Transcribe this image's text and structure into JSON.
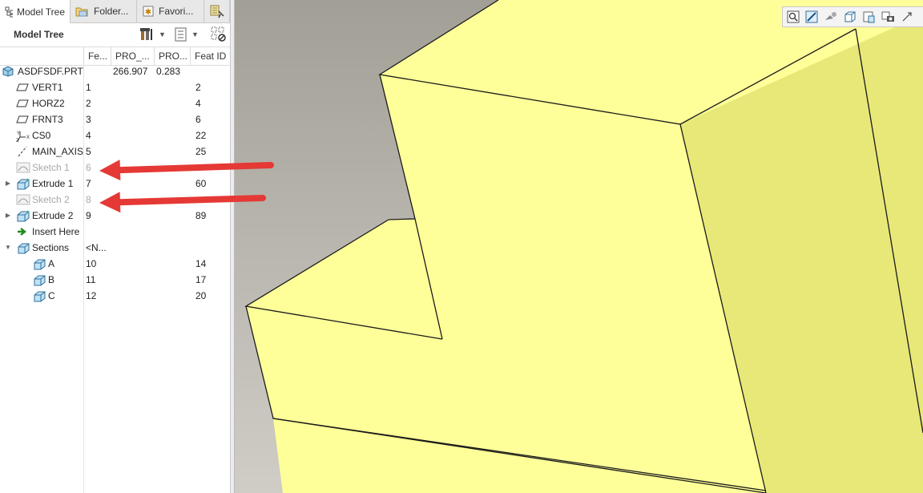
{
  "tabs": [
    {
      "label": "Model Tree",
      "icon": "model-tree-icon"
    },
    {
      "label": "Folder...",
      "icon": "folder-browser-icon"
    },
    {
      "label": "Favori...",
      "icon": "favorites-icon"
    },
    {
      "label": "",
      "icon": "layers-icon"
    }
  ],
  "panel": {
    "title": "Model Tree",
    "tools": [
      "settings-icon",
      "show-list-icon",
      "filter-icon"
    ]
  },
  "columns": [
    "",
    "Fe...",
    "PRO_...",
    "PRO...",
    "Feat ID"
  ],
  "tree": [
    {
      "name": "ASDFSDF.PRT",
      "c1": "",
      "c2": "266.907",
      "c3": "0.283",
      "c4": "",
      "indent": 0,
      "icon": "part-icon",
      "expand": "",
      "suppressed": false
    },
    {
      "name": "VERT1",
      "c1": "1",
      "c2": "",
      "c3": "",
      "c4": "2",
      "indent": 1,
      "icon": "datum-plane-icon",
      "expand": "",
      "suppressed": false
    },
    {
      "name": "HORZ2",
      "c1": "2",
      "c2": "",
      "c3": "",
      "c4": "4",
      "indent": 1,
      "icon": "datum-plane-icon",
      "expand": "",
      "suppressed": false
    },
    {
      "name": "FRNT3",
      "c1": "3",
      "c2": "",
      "c3": "",
      "c4": "6",
      "indent": 1,
      "icon": "datum-plane-icon",
      "expand": "",
      "suppressed": false
    },
    {
      "name": "CS0",
      "c1": "4",
      "c2": "",
      "c3": "",
      "c4": "22",
      "indent": 1,
      "icon": "coordinate-system-icon",
      "expand": "",
      "suppressed": false
    },
    {
      "name": "MAIN_AXIS",
      "c1": "5",
      "c2": "",
      "c3": "",
      "c4": "25",
      "indent": 1,
      "icon": "datum-axis-icon",
      "expand": "",
      "suppressed": false
    },
    {
      "name": "Sketch 1",
      "c1": "6",
      "c2": "",
      "c3": "",
      "c4": "",
      "indent": 1,
      "icon": "sketch-icon",
      "expand": "",
      "suppressed": true
    },
    {
      "name": "Extrude 1",
      "c1": "7",
      "c2": "",
      "c3": "",
      "c4": "60",
      "indent": 1,
      "icon": "extrude-icon",
      "expand": "▶",
      "suppressed": false
    },
    {
      "name": "Sketch 2",
      "c1": "8",
      "c2": "",
      "c3": "",
      "c4": "",
      "indent": 1,
      "icon": "sketch-icon",
      "expand": "",
      "suppressed": true
    },
    {
      "name": "Extrude 2",
      "c1": "9",
      "c2": "",
      "c3": "",
      "c4": "89",
      "indent": 1,
      "icon": "extrude-icon",
      "expand": "▶",
      "suppressed": false
    },
    {
      "name": "Insert Here",
      "c1": "",
      "c2": "",
      "c3": "",
      "c4": "",
      "indent": 1,
      "icon": "insert-here-arrow-icon",
      "expand": "",
      "suppressed": false
    },
    {
      "name": "Sections",
      "c1": "<N...",
      "c2": "",
      "c3": "",
      "c4": "",
      "indent": 1,
      "icon": "sections-icon",
      "expand": "▼",
      "suppressed": false
    },
    {
      "name": "A",
      "c1": "10",
      "c2": "",
      "c3": "",
      "c4": "14",
      "indent": 2,
      "icon": "section-icon",
      "expand": "",
      "suppressed": false
    },
    {
      "name": "B",
      "c1": "11",
      "c2": "",
      "c3": "",
      "c4": "17",
      "indent": 2,
      "icon": "section-icon",
      "expand": "",
      "suppressed": false
    },
    {
      "name": "C",
      "c1": "12",
      "c2": "",
      "c3": "",
      "c4": "20",
      "indent": 2,
      "icon": "section-icon",
      "expand": "",
      "suppressed": false
    }
  ],
  "annotations": [
    {
      "target": "Sketch 1",
      "icon": "red-arrow-icon",
      "color": "#e53935"
    },
    {
      "target": "Sketch 2",
      "icon": "red-arrow-icon",
      "color": "#e53935"
    }
  ],
  "viewport": {
    "toolbar": [
      "refit-icon",
      "zoom-in-icon",
      "zoom-out-icon",
      "repaint-icon",
      "display-style-icon",
      "saved-orientations-icon",
      "view-manager-icon",
      "datum-display-icon"
    ],
    "colors": {
      "model_face": "#ffff99",
      "model_shade": "#e8e878",
      "edge": "#1a1a1a",
      "arrow": "#e53935"
    }
  }
}
